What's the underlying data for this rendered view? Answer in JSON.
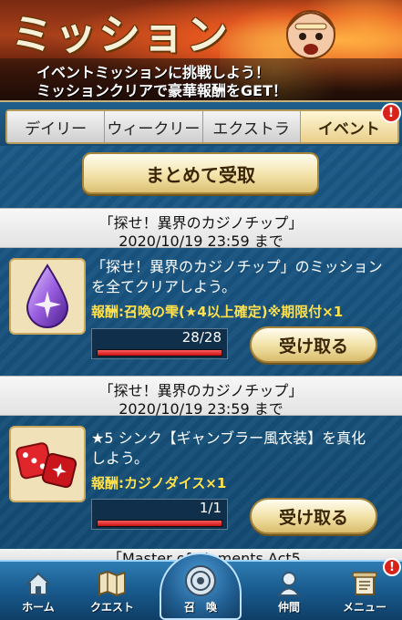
{
  "header": {
    "title": "ミッション",
    "subtitle_line1": "イベントミッションに挑戦しよう！",
    "subtitle_line2": "ミッションクリアで豪華報酬をGET！"
  },
  "tabs": [
    {
      "label": "デイリー",
      "active": false
    },
    {
      "label": "ウィークリー",
      "active": false
    },
    {
      "label": "エクストラ",
      "active": false
    },
    {
      "label": "イベント",
      "active": true
    }
  ],
  "tab_badge": "!",
  "bulk_receive_label": "まとめて受取",
  "missions": [
    {
      "name": "「探せ！異界のカジノチップ」",
      "deadline": "2020/10/19 23:59 まで",
      "desc_line1": "「探せ！異界のカジノチップ」のミッション",
      "desc_line2": "を全てクリアしよう。",
      "reward": "報酬:召喚の雫(★4以上確定)※期限付×1",
      "progress_text": "28/28",
      "progress_fraction": 1.0,
      "receive_label": "受け取る",
      "icon": "summon-drop-icon"
    },
    {
      "name": "「探せ！異界のカジノチップ」",
      "deadline": "2020/10/19 23:59 まで",
      "desc_line1": "★5 シンク【ギャンブラー風衣装】を真化",
      "desc_line2": "しよう。",
      "reward": "報酬:カジノダイス×1",
      "progress_text": "1/1",
      "progress_fraction": 1.0,
      "receive_label": "受け取る",
      "icon": "casino-dice-icon"
    }
  ],
  "next_mission_peek": "「Master of Elements Act5",
  "bottom_nav": [
    {
      "label": "ホーム",
      "icon": "home-icon"
    },
    {
      "label": "クエスト",
      "icon": "quest-map-icon"
    },
    {
      "label": "召　喚",
      "icon": "summon-emblem-icon"
    },
    {
      "label": "仲間",
      "icon": "ally-icon"
    },
    {
      "label": "メニュー",
      "icon": "menu-scroll-icon"
    }
  ],
  "nav_badge": "!",
  "colors": {
    "reward_text": "#ffe14d",
    "progress_fill": "#c51111",
    "badge": "#d8221a",
    "content_bg": "#134a72"
  }
}
